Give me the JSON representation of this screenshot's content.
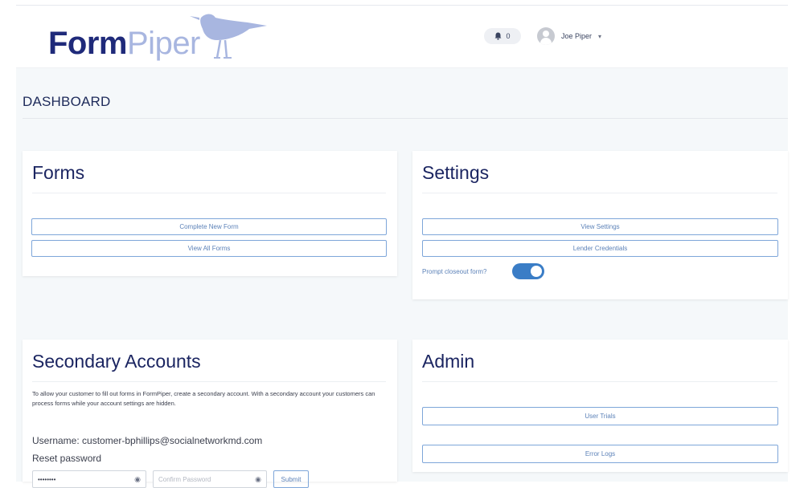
{
  "brand": {
    "part1": "Form",
    "part2": "Piper"
  },
  "header": {
    "notification_count": "0",
    "user_name": "Joe Piper",
    "caret": "▾"
  },
  "dashboard": {
    "title": "DASHBOARD"
  },
  "forms": {
    "title": "Forms",
    "complete_new": "Complete New Form",
    "view_all": "View All Forms"
  },
  "settings": {
    "title": "Settings",
    "view_settings": "View Settings",
    "lender_credentials": "Lender Credentials",
    "prompt_label": "Prompt closeout form?",
    "prompt_enabled": true
  },
  "secondary": {
    "title": "Secondary Accounts",
    "description": "To allow your customer to fill out forms in FormPiper, create a secondary account. With a secondary account your customers can process forms while your account settings are hidden.",
    "username": "Username: customer-bphillips@socialnetworkmd.com",
    "reset_label": "Reset password",
    "password_value": "••••••••",
    "confirm_placeholder": "Confirm Password",
    "submit": "Submit"
  },
  "admin": {
    "title": "Admin",
    "user_trials": "User Trials",
    "error_logs": "Error Logs"
  },
  "colors": {
    "brand_dark": "#1f2a7a",
    "brand_light": "#a8b6e0",
    "button_border": "#7ea6d9",
    "toggle_on": "#3a7dc6"
  },
  "icons": [
    "bell-icon",
    "user-avatar-icon",
    "chevron-down-icon",
    "eye-icon",
    "bird-logo-icon"
  ]
}
